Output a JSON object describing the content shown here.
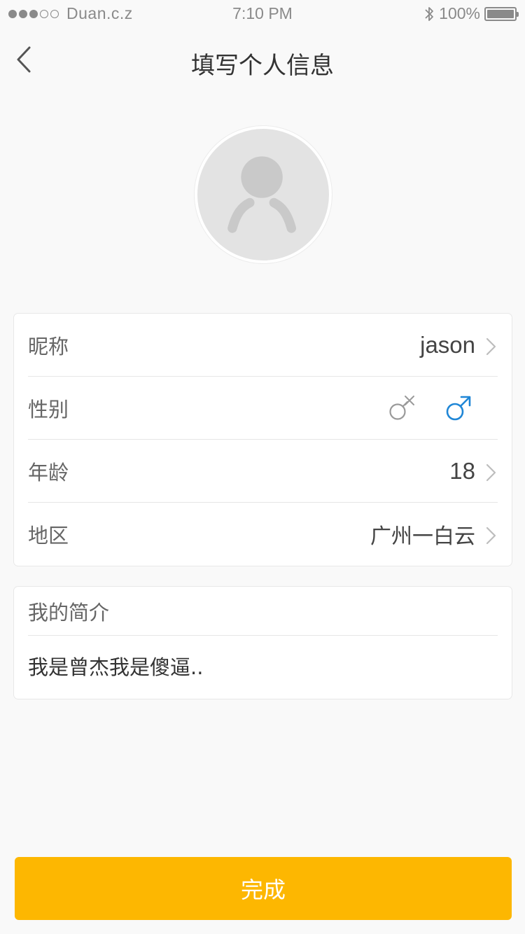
{
  "status_bar": {
    "carrier": "Duan.c.z",
    "time": "7:10 PM",
    "battery": "100%",
    "signal_bars_filled": 3,
    "signal_bars_total": 5
  },
  "nav": {
    "title": "填写个人信息",
    "back_icon": "chevron-left-icon"
  },
  "profile": {
    "avatar_icon": "default-avatar-icon",
    "rows": [
      {
        "label": "昵称",
        "value": "jason"
      },
      {
        "label": "性别",
        "female_icon": "female-symbol-icon",
        "male_icon": "male-symbol-icon",
        "selected": "male"
      },
      {
        "label": "年龄",
        "value": "18"
      },
      {
        "label": "地区",
        "value": "广州一白云"
      }
    ]
  },
  "bio": {
    "header": "我的简介",
    "text": "我是曾杰我是傻逼.."
  },
  "done_button": {
    "label": "完成"
  },
  "colors": {
    "accent": "#fdb701",
    "male_selected": "#1f86d6",
    "inactive_icon": "#9a9a9a",
    "background": "#f9f9f9"
  }
}
